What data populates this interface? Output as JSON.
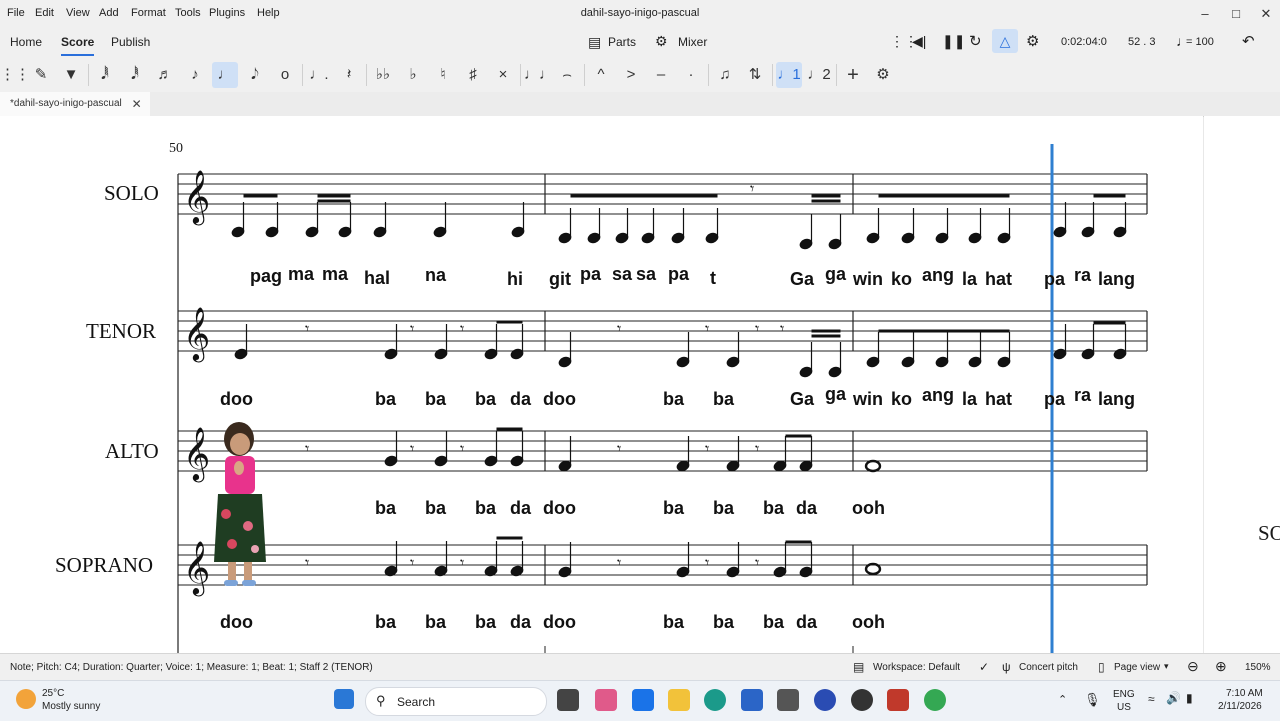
{
  "menu": [
    "File",
    "Edit",
    "View",
    "Add",
    "Format",
    "Tools",
    "Plugins",
    "Help"
  ],
  "window_title": "dahil-sayo-inigo-pascual",
  "workspace_tabs": [
    "Home",
    "Score",
    "Publish"
  ],
  "topbar": {
    "parts_label": "Parts",
    "mixer_label": "Mixer",
    "time": "0:02:04:0",
    "measure_beat": "52 . 3",
    "tempo": "= 100"
  },
  "document_tab": "*dahil-sayo-inigo-pascual",
  "score": {
    "measure_number": "50",
    "instruments": [
      "SOLO",
      "TENOR",
      "ALTO",
      "SOPRANO"
    ],
    "next_system_label": "SO",
    "lyrics": {
      "solo": [
        "pag",
        "ma",
        "ma",
        "hal",
        "na",
        "hi",
        "git",
        "pa",
        "sa",
        "sa",
        "pa",
        "t",
        "Ga",
        "ga",
        "win",
        "ko",
        "ang",
        "la",
        "hat",
        "pa",
        "ra",
        "lang"
      ],
      "tenor": [
        "doo",
        "ba",
        "ba",
        "ba",
        "da",
        "doo",
        "ba",
        "ba",
        "Ga",
        "ga",
        "win",
        "ko",
        "ang",
        "la",
        "hat",
        "pa",
        "ra",
        "lang"
      ],
      "alto": [
        "ba",
        "ba",
        "ba",
        "da",
        "doo",
        "ba",
        "ba",
        "ba",
        "da",
        "ooh"
      ],
      "soprano": [
        "doo",
        "ba",
        "ba",
        "ba",
        "da",
        "doo",
        "ba",
        "ba",
        "ba",
        "da",
        "ooh"
      ]
    }
  },
  "statusbar": {
    "text": "Note; Pitch: C4; Duration: Quarter; Voice: 1; Measure: 1; Beat: 1; Staff 2 (TENOR)",
    "workspace": "Workspace: Default",
    "concert_pitch": "Concert pitch",
    "page_view": "Page view",
    "zoom": "150%"
  },
  "taskbar": {
    "weather_temp": "25°C",
    "weather_desc": "Mostly sunny",
    "search": "Search",
    "lang": "ENG",
    "region": "US",
    "time": "7:10 AM",
    "date": "2/11/2026"
  },
  "colors": {
    "accent": "#2a6fdb",
    "playhead": "#2f7fd0"
  }
}
